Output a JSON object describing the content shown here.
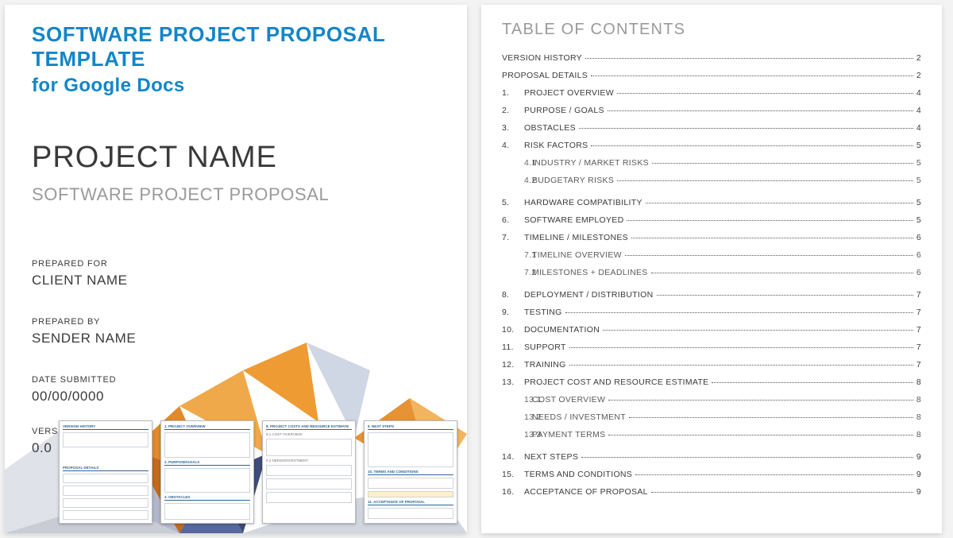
{
  "cover": {
    "header_line1": "SOFTWARE PROJECT PROPOSAL TEMPLATE",
    "header_line2": "for Google Docs",
    "project_name": "PROJECT NAME",
    "subtitle": "SOFTWARE PROJECT PROPOSAL",
    "prepared_for_label": "PREPARED FOR",
    "prepared_for_value": "CLIENT NAME",
    "prepared_by_label": "PREPARED BY",
    "prepared_by_value": "SENDER NAME",
    "date_label": "DATE SUBMITTED",
    "date_value": "00/00/0000",
    "version_label": "VERSION NO.",
    "version_value": "0.0"
  },
  "thumbnails": {
    "p1_hdr1": "VERSION HISTORY",
    "p1_hdr2": "PROPOSAL DETAILS",
    "p2_hdr1": "1. PROJECT OVERVIEW",
    "p2_hdr2": "2. PURPOSE/GOALS",
    "p2_hdr3": "3. OBSTACLES",
    "p3_hdr1": "8. PROJECT COSTS AND RESOURCE ESTIMATE",
    "p3_s1": "8.1 COST OVERVIEW",
    "p3_s2": "8.2 NEEDS/INVESTMENT",
    "p4_hdr1": "9. NEXT STEPS",
    "p4_hdr2": "10. TERMS AND CONDITIONS",
    "p4_hdr3": "11. ACCEPTANCE OF PROPOSAL"
  },
  "toc": {
    "title": "TABLE OF CONTENTS",
    "rows": [
      {
        "num": "",
        "label": "VERSION HISTORY",
        "page": "2",
        "sub": false,
        "nonum": true
      },
      {
        "num": "",
        "label": "PROPOSAL DETAILS",
        "page": "2",
        "sub": false,
        "nonum": true
      },
      {
        "num": "1.",
        "label": "PROJECT OVERVIEW",
        "page": "4",
        "sub": false
      },
      {
        "num": "2.",
        "label": "PURPOSE / GOALS",
        "page": "4",
        "sub": false
      },
      {
        "num": "3.",
        "label": "OBSTACLES",
        "page": "4",
        "sub": false
      },
      {
        "num": "4.",
        "label": "RISK FACTORS",
        "page": "5",
        "sub": false
      },
      {
        "num": "4.1",
        "label": "INDUSTRY / MARKET RISKS",
        "page": "5",
        "sub": true
      },
      {
        "num": "4.2",
        "label": "BUDGETARY RISKS",
        "page": "5",
        "sub": true
      },
      {
        "num": "5.",
        "label": "HARDWARE COMPATIBILITY",
        "page": "5",
        "sub": false
      },
      {
        "num": "6.",
        "label": "SOFTWARE EMPLOYED",
        "page": "5",
        "sub": false
      },
      {
        "num": "7.",
        "label": "TIMELINE / MILESTONES",
        "page": "6",
        "sub": false
      },
      {
        "num": "7.1",
        "label": "TIMELINE OVERVIEW",
        "page": "6",
        "sub": true
      },
      {
        "num": "7.2",
        "label": "MILESTONES + DEADLINES",
        "page": "6",
        "sub": true
      },
      {
        "num": "8.",
        "label": "DEPLOYMENT / DISTRIBUTION",
        "page": "7",
        "sub": false
      },
      {
        "num": "9.",
        "label": "TESTING",
        "page": "7",
        "sub": false
      },
      {
        "num": "10.",
        "label": "DOCUMENTATION",
        "page": "7",
        "sub": false
      },
      {
        "num": "11.",
        "label": "SUPPORT",
        "page": "7",
        "sub": false
      },
      {
        "num": "12.",
        "label": "TRAINING",
        "page": "7",
        "sub": false
      },
      {
        "num": "13.",
        "label": "PROJECT COST AND RESOURCE ESTIMATE",
        "page": "8",
        "sub": false
      },
      {
        "num": "13.1",
        "label": "COST OVERVIEW",
        "page": "8",
        "sub": true
      },
      {
        "num": "13.2",
        "label": "NEEDS / INVESTMENT",
        "page": "8",
        "sub": true
      },
      {
        "num": "13.3",
        "label": "PAYMENT TERMS",
        "page": "8",
        "sub": true
      },
      {
        "num": "14.",
        "label": "NEXT STEPS",
        "page": "9",
        "sub": false
      },
      {
        "num": "15.",
        "label": "TERMS AND CONDITIONS",
        "page": "9",
        "sub": false
      },
      {
        "num": "16.",
        "label": "ACCEPTANCE OF PROPOSAL",
        "page": "9",
        "sub": false
      }
    ]
  }
}
